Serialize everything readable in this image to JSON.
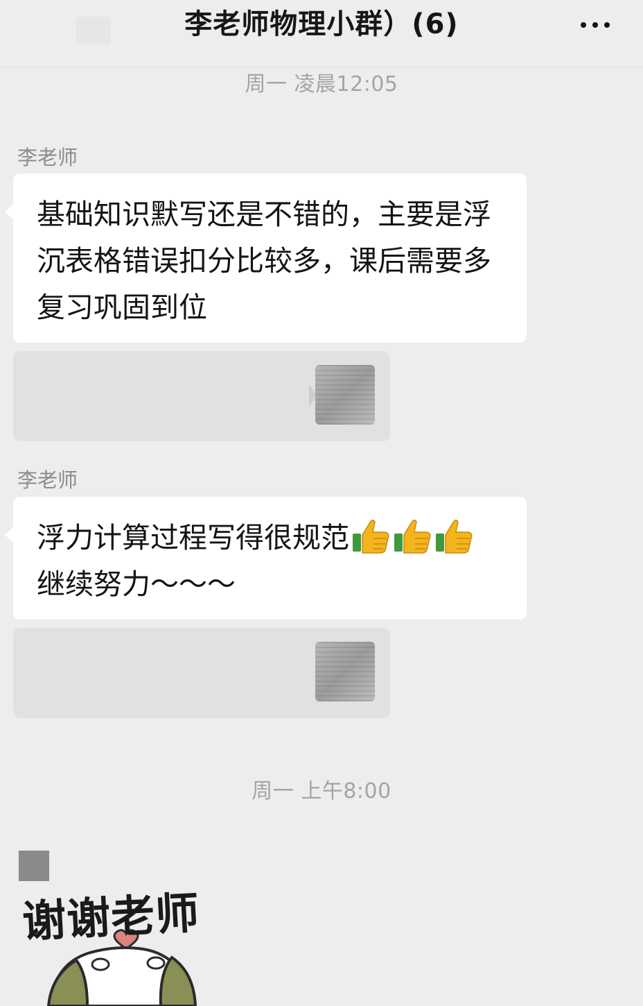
{
  "header": {
    "title": "李老师物理小群）(6)",
    "more_icon": "more-dots-icon"
  },
  "messages": {
    "ts1": "周一 凌晨12:05",
    "m1": {
      "sender": "李老师",
      "text": "基础知识默写还是不错的，主要是浮沉表格错误扣分比较多，课后需要多复习巩固到位"
    },
    "m2": {
      "sender": "李老师",
      "text": "浮力计算过程写得很规范",
      "text2": "继续努力～～～",
      "emoji": "thumbs-up"
    },
    "ts2": "周一 上午8:00",
    "sticker": {
      "text": "谢谢老师"
    }
  },
  "colors": {
    "background": "#ededed",
    "bubble": "#ffffff",
    "timestamp": "#a4a4a4"
  }
}
